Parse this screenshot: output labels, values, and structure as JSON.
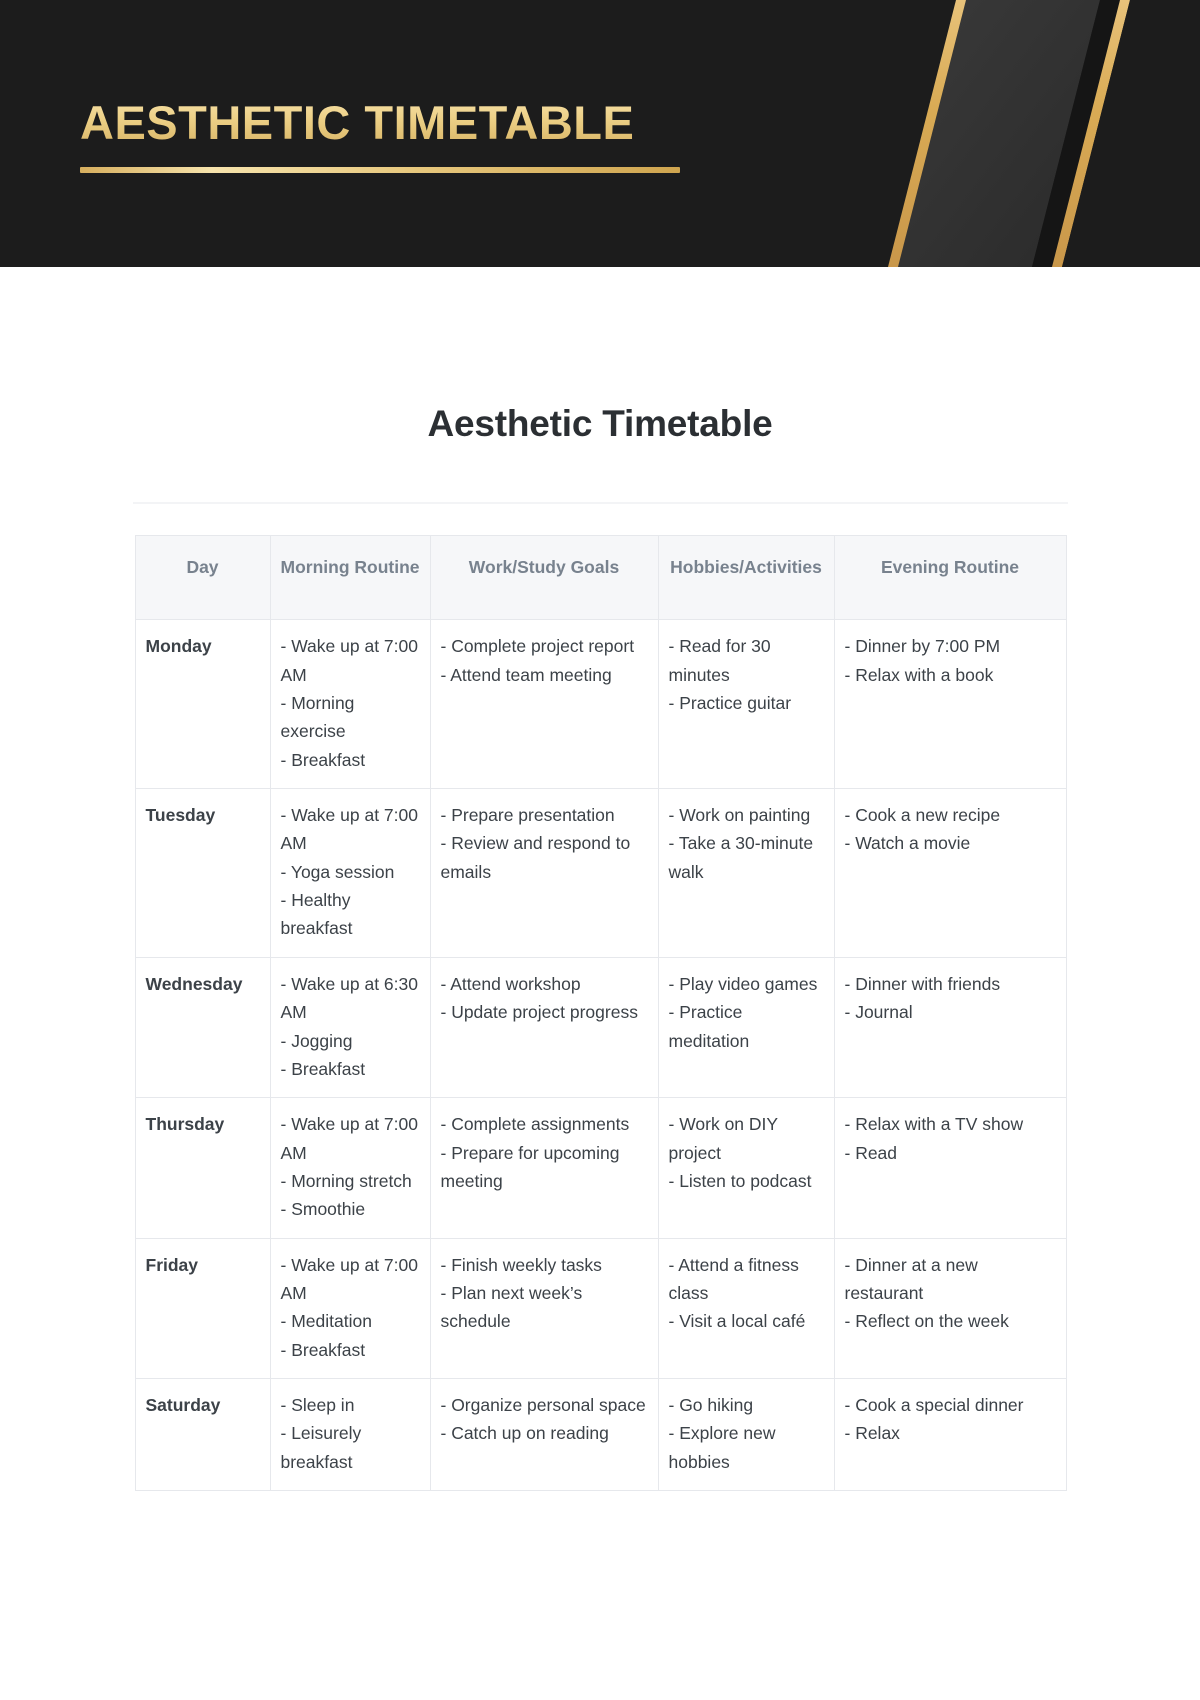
{
  "banner": {
    "title": "AESTHETIC TIMETABLE",
    "background_color": "#1c1c1c",
    "gold_color": "#eccd83",
    "stripe_gold": "#d8ae5e"
  },
  "document": {
    "title": "Aesthetic Timetable"
  },
  "table": {
    "headers": [
      "Day",
      "Morning Routine",
      "Work/Study Goals",
      "Hobbies/Activities",
      "Evening Routine"
    ],
    "rows": [
      {
        "day": "Monday",
        "morning": [
          "- Wake up at 7:00 AM",
          "- Morning exercise",
          "- Breakfast"
        ],
        "work": [
          "- Complete project report",
          "- Attend team meeting"
        ],
        "hobbies": [
          "- Read for 30 minutes",
          "- Practice guitar"
        ],
        "evening": [
          "- Dinner by 7:00 PM",
          "- Relax with a book"
        ]
      },
      {
        "day": "Tuesday",
        "morning": [
          "- Wake up at 7:00 AM",
          "- Yoga session",
          "- Healthy breakfast"
        ],
        "work": [
          "- Prepare presentation",
          "- Review and respond to emails"
        ],
        "hobbies": [
          "- Work on painting",
          "- Take a 30-minute walk"
        ],
        "evening": [
          "- Cook a new recipe",
          "- Watch a movie"
        ]
      },
      {
        "day": "Wednesday",
        "morning": [
          "- Wake up at 6:30 AM",
          "- Jogging",
          "- Breakfast"
        ],
        "work": [
          "- Attend workshop",
          "- Update project progress"
        ],
        "hobbies": [
          "- Play video games",
          "- Practice meditation"
        ],
        "evening": [
          "- Dinner with friends",
          "- Journal"
        ]
      },
      {
        "day": "Thursday",
        "morning": [
          "- Wake up at 7:00 AM",
          "- Morning stretch",
          "- Smoothie"
        ],
        "work": [
          "- Complete assignments",
          "- Prepare for upcoming meeting"
        ],
        "hobbies": [
          "- Work on DIY project",
          "- Listen to podcast"
        ],
        "evening": [
          "- Relax with a TV show",
          "- Read"
        ]
      },
      {
        "day": "Friday",
        "morning": [
          "- Wake up at 7:00 AM",
          "- Meditation",
          "- Breakfast"
        ],
        "work": [
          "- Finish weekly tasks",
          "- Plan next week’s schedule"
        ],
        "hobbies": [
          "- Attend a fitness class",
          "- Visit a local café"
        ],
        "evening": [
          "- Dinner at a new restaurant",
          "- Reflect on the week"
        ]
      },
      {
        "day": "Saturday",
        "morning": [
          "- Sleep in",
          "- Leisurely breakfast"
        ],
        "work": [
          "- Organize personal space",
          "- Catch up on reading"
        ],
        "hobbies": [
          "- Go hiking",
          "- Explore new hobbies"
        ],
        "evening": [
          "- Cook a special dinner",
          "- Relax"
        ]
      }
    ]
  }
}
